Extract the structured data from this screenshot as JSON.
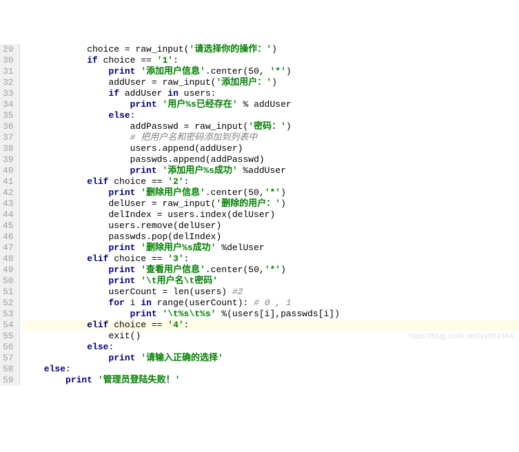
{
  "lines": [
    {
      "n": 29,
      "indent": 12,
      "tokens": [
        {
          "t": "choice = "
        },
        {
          "t": "raw_input",
          "c": "fn"
        },
        {
          "t": "("
        },
        {
          "t": "'请选择你的操作：'",
          "c": "str"
        },
        {
          "t": ")"
        }
      ]
    },
    {
      "n": 30,
      "indent": 12,
      "tokens": [
        {
          "t": "if ",
          "c": "kw"
        },
        {
          "t": "choice == "
        },
        {
          "t": "'1'",
          "c": "str"
        },
        {
          "t": ":"
        }
      ]
    },
    {
      "n": 31,
      "indent": 16,
      "tokens": [
        {
          "t": "print ",
          "c": "kw"
        },
        {
          "t": "'添加用户信息'",
          "c": "str"
        },
        {
          "t": ".center("
        },
        {
          "t": "50"
        },
        {
          "t": ", "
        },
        {
          "t": "'*'",
          "c": "str"
        },
        {
          "t": ")"
        }
      ]
    },
    {
      "n": 32,
      "indent": 16,
      "tokens": [
        {
          "t": "addUser = "
        },
        {
          "t": "raw_input",
          "c": "fn"
        },
        {
          "t": "("
        },
        {
          "t": "'添加用户：'",
          "c": "str"
        },
        {
          "t": ")"
        }
      ]
    },
    {
      "n": 33,
      "indent": 16,
      "tokens": [
        {
          "t": "if ",
          "c": "kw"
        },
        {
          "t": "addUser "
        },
        {
          "t": "in ",
          "c": "kw"
        },
        {
          "t": "users:"
        }
      ]
    },
    {
      "n": 34,
      "indent": 20,
      "tokens": [
        {
          "t": "print ",
          "c": "kw"
        },
        {
          "t": "'用户%s已经存在'",
          "c": "str"
        },
        {
          "t": " % addUser"
        }
      ]
    },
    {
      "n": 35,
      "indent": 16,
      "tokens": [
        {
          "t": "else",
          "c": "kw"
        },
        {
          "t": ":"
        }
      ]
    },
    {
      "n": 36,
      "indent": 20,
      "tokens": [
        {
          "t": "addPasswd = "
        },
        {
          "t": "raw_input",
          "c": "fn"
        },
        {
          "t": "("
        },
        {
          "t": "'密码：'",
          "c": "str"
        },
        {
          "t": ")"
        }
      ]
    },
    {
      "n": 37,
      "indent": 20,
      "tokens": [
        {
          "t": "# 把用户名和密码添加到列表中",
          "c": "cmt"
        }
      ]
    },
    {
      "n": 38,
      "indent": 20,
      "tokens": [
        {
          "t": "users.append(addUser)"
        }
      ]
    },
    {
      "n": 39,
      "indent": 20,
      "tokens": [
        {
          "t": "passwds.append(addPasswd)"
        }
      ]
    },
    {
      "n": 40,
      "indent": 20,
      "tokens": [
        {
          "t": "print ",
          "c": "kw"
        },
        {
          "t": "'添加用户%s成功'",
          "c": "str"
        },
        {
          "t": " %addUser"
        }
      ]
    },
    {
      "n": 41,
      "indent": 12,
      "tokens": [
        {
          "t": "elif ",
          "c": "kw"
        },
        {
          "t": "choice == "
        },
        {
          "t": "'2'",
          "c": "str"
        },
        {
          "t": ":"
        }
      ]
    },
    {
      "n": 42,
      "indent": 16,
      "tokens": [
        {
          "t": "print ",
          "c": "kw"
        },
        {
          "t": "'删除用户信息'",
          "c": "str"
        },
        {
          "t": ".center("
        },
        {
          "t": "50"
        },
        {
          "t": ","
        },
        {
          "t": "'*'",
          "c": "str"
        },
        {
          "t": ")"
        }
      ]
    },
    {
      "n": 43,
      "indent": 16,
      "tokens": [
        {
          "t": "delUser = "
        },
        {
          "t": "raw_input",
          "c": "fn"
        },
        {
          "t": "("
        },
        {
          "t": "'删除的用户：'",
          "c": "str"
        },
        {
          "t": ")"
        }
      ]
    },
    {
      "n": 44,
      "indent": 16,
      "tokens": [
        {
          "t": "delIndex = users.index(delUser)"
        }
      ]
    },
    {
      "n": 45,
      "indent": 16,
      "tokens": [
        {
          "t": "users.remove(delUser)"
        }
      ]
    },
    {
      "n": 46,
      "indent": 16,
      "tokens": [
        {
          "t": "passwds.pop(delIndex)"
        }
      ]
    },
    {
      "n": 47,
      "indent": 16,
      "tokens": [
        {
          "t": "print ",
          "c": "kw"
        },
        {
          "t": "'删除用户%s成功'",
          "c": "str"
        },
        {
          "t": " %delUser"
        }
      ]
    },
    {
      "n": 48,
      "indent": 12,
      "tokens": [
        {
          "t": "elif ",
          "c": "kw"
        },
        {
          "t": "choice == "
        },
        {
          "t": "'3'",
          "c": "str"
        },
        {
          "t": ":"
        }
      ]
    },
    {
      "n": 49,
      "indent": 16,
      "tokens": [
        {
          "t": "print ",
          "c": "kw"
        },
        {
          "t": "'查看用户信息'",
          "c": "str"
        },
        {
          "t": ".center("
        },
        {
          "t": "50"
        },
        {
          "t": ","
        },
        {
          "t": "'*'",
          "c": "str"
        },
        {
          "t": ")"
        }
      ]
    },
    {
      "n": 50,
      "indent": 16,
      "tokens": [
        {
          "t": "print ",
          "c": "kw"
        },
        {
          "t": "'\\t用户名\\t密码'",
          "c": "str"
        }
      ]
    },
    {
      "n": 51,
      "indent": 16,
      "tokens": [
        {
          "t": "userCount = "
        },
        {
          "t": "len",
          "c": "fn"
        },
        {
          "t": "(users) "
        },
        {
          "t": "#2",
          "c": "cmt"
        }
      ]
    },
    {
      "n": 52,
      "indent": 16,
      "tokens": [
        {
          "t": "for ",
          "c": "kw"
        },
        {
          "t": "i "
        },
        {
          "t": "in ",
          "c": "kw"
        },
        {
          "t": "range",
          "c": "fn"
        },
        {
          "t": "(userCount): "
        },
        {
          "t": "# 0 , 1",
          "c": "cmt"
        }
      ]
    },
    {
      "n": 53,
      "indent": 20,
      "tokens": [
        {
          "t": "print ",
          "c": "kw"
        },
        {
          "t": "'\\t%s\\t%s'",
          "c": "str"
        },
        {
          "t": " %(users[i],passwds[i])"
        }
      ]
    },
    {
      "n": 54,
      "indent": 12,
      "hl": true,
      "tokens": [
        {
          "t": "elif ",
          "c": "kw"
        },
        {
          "t": "choice == "
        },
        {
          "t": "'4'",
          "c": "str"
        },
        {
          "t": ":"
        }
      ]
    },
    {
      "n": 55,
      "indent": 16,
      "tokens": [
        {
          "t": "exit",
          "c": "fn"
        },
        {
          "t": "()"
        }
      ]
    },
    {
      "n": 56,
      "indent": 12,
      "tokens": [
        {
          "t": "else",
          "c": "kw"
        },
        {
          "t": ":"
        }
      ]
    },
    {
      "n": 57,
      "indent": 16,
      "tokens": [
        {
          "t": "print ",
          "c": "kw"
        },
        {
          "t": "'请输入正确的选择'",
          "c": "str"
        }
      ]
    },
    {
      "n": 58,
      "indent": 4,
      "tokens": [
        {
          "t": "else",
          "c": "kw"
        },
        {
          "t": ":"
        }
      ]
    },
    {
      "n": 59,
      "indent": 8,
      "tokens": [
        {
          "t": "print ",
          "c": "kw"
        },
        {
          "t": "'管理员登陆失败！'",
          "c": "str"
        }
      ]
    }
  ],
  "watermark": "https://blog.csdn.net/lyy962464"
}
